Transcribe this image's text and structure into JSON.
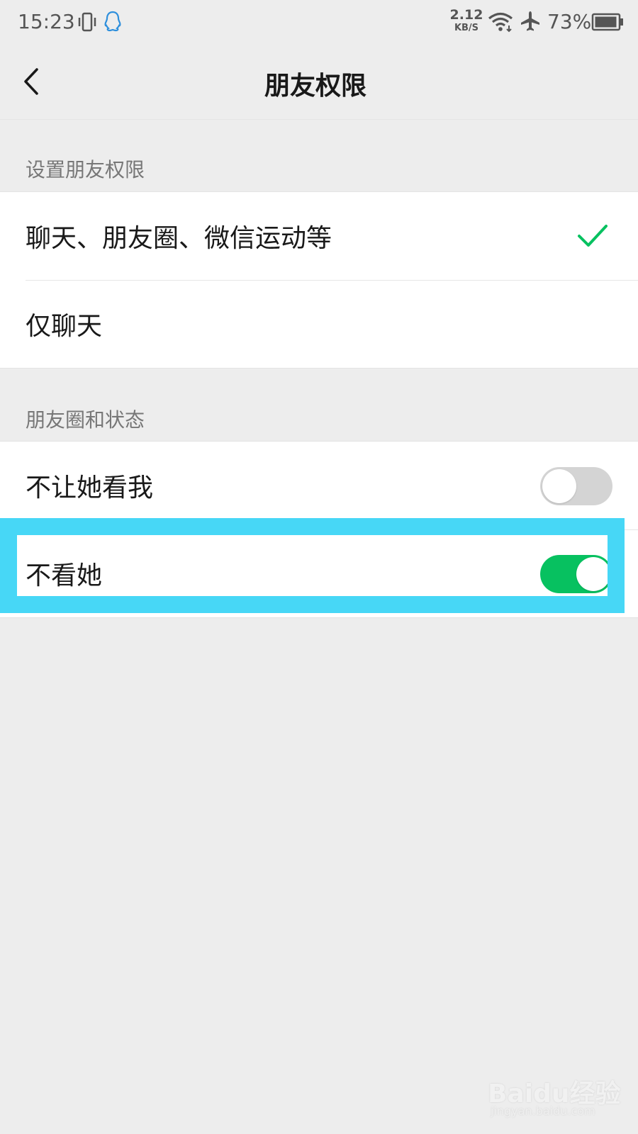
{
  "status_bar": {
    "time": "15:23",
    "net_speed_value": "2.12",
    "net_speed_unit": "KB/S",
    "battery": "73%"
  },
  "nav": {
    "title": "朋友权限"
  },
  "sections": {
    "permission": {
      "title": "设置朋友权限",
      "items": [
        {
          "label": "聊天、朋友圈、微信运动等",
          "selected": true
        },
        {
          "label": "仅聊天",
          "selected": false
        }
      ]
    },
    "moments": {
      "title": "朋友圈和状态",
      "items": [
        {
          "label": "不让她看我",
          "enabled": false
        },
        {
          "label": "不看她",
          "enabled": true
        }
      ]
    }
  },
  "watermark": {
    "logo": "Baidu经验",
    "url": "jingyan.baidu.com"
  },
  "colors": {
    "accent_green": "#07c160",
    "highlight": "#47d7f6"
  }
}
